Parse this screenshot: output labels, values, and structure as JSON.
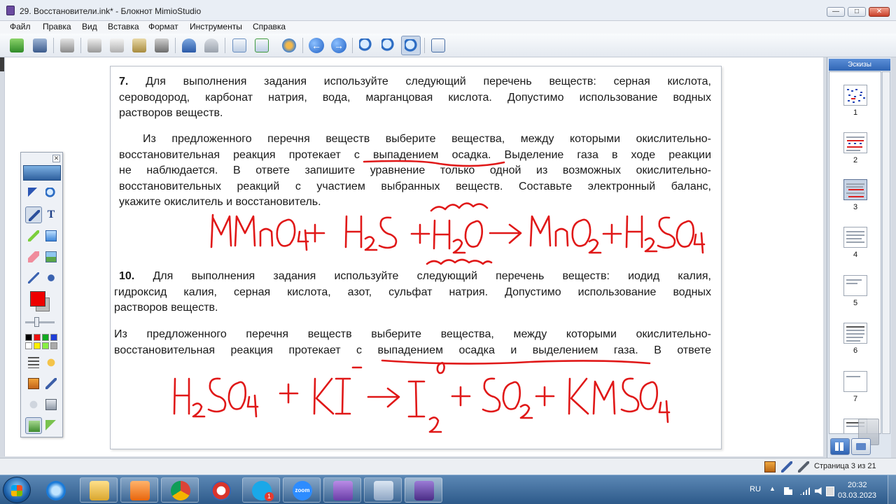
{
  "window": {
    "title": "29. Восстановители.ink* - Блокнот MimioStudio",
    "minimize_glyph": "—",
    "maximize_glyph": "□",
    "close_glyph": "✕"
  },
  "menu": {
    "items": [
      "Файл",
      "Правка",
      "Вид",
      "Вставка",
      "Формат",
      "Инструменты",
      "Справка"
    ]
  },
  "toolbar": {
    "icons": [
      "open-icon",
      "save-icon",
      "print-icon",
      "cut-icon",
      "copy-icon",
      "paste-icon",
      "delete-icon",
      "undo-icon",
      "redo-icon",
      "new-page-icon",
      "duplicate-page-icon",
      "gallery-icon",
      "previous-page-icon",
      "next-page-icon",
      "zoom-in-icon",
      "zoom-out-icon",
      "zoom-fit-icon",
      "screen-icon"
    ],
    "prev_glyph": "←",
    "next_glyph": "→"
  },
  "palette": {
    "close_glyph": "✕",
    "text_tool_glyph": "T",
    "colors": {
      "current": "#ee0000",
      "swatches": [
        "#000000",
        "#ee1111",
        "#11aa22",
        "#1f3fd8",
        "#ffffff",
        "#ffee00",
        "#88ee44",
        "#aaaaaa"
      ]
    }
  },
  "page": {
    "task7": {
      "number": "7.",
      "lines": [
        "Для выполнения задания используйте следующий перечень веществ: серная кислота,",
        "сероводород, карбонат натрия, вода, марганцовая кислота. Допустимо использование водных",
        "растворов веществ."
      ],
      "para2": [
        "Из предложенного перечня веществ выберите вещества, между которыми окислительно-",
        "восстановительная реакция протекает с выпадением осадка. Выделение газа в ходе реакции",
        "не наблюдается. В ответе запишите уравнение только одной из возможных окислительно-",
        "восстановительных реакций с участием выбранных веществ. Составьте электронный баланс,",
        "укажите окислитель и восстановитель."
      ]
    },
    "task10": {
      "number": "10.",
      "lines": [
        "Для выполнения задания используйте следующий перечень веществ: иодид калия,",
        "гидроксид калия, серная кислота, азот, сульфат натрия. Допустимо использование водных",
        "растворов веществ."
      ],
      "para2": [
        "Из предложенного перечня веществ выберите вещества, между которыми окислительно-",
        "восстановительная реакция протекает с выпадением осадка и выделением газа. В ответе"
      ]
    }
  },
  "sidebar": {
    "header": "Эскизы",
    "thumbnails": [
      "1",
      "2",
      "3",
      "4",
      "5",
      "6",
      "7"
    ],
    "selected": "3"
  },
  "status": {
    "page_label": "Страница 3 из 21"
  },
  "taskbar": {
    "apps": [
      "ie",
      "explorer",
      "media-player",
      "chrome",
      "ccleaner",
      "skype",
      "zoom",
      "mimio-studio",
      "calculator",
      "mimio-notebook"
    ],
    "skype_badge": "1",
    "zoom_label": "zoom",
    "lang": "RU",
    "time": "20:32",
    "date": "03.03.2023"
  },
  "ink": {
    "color": "#e01818"
  }
}
